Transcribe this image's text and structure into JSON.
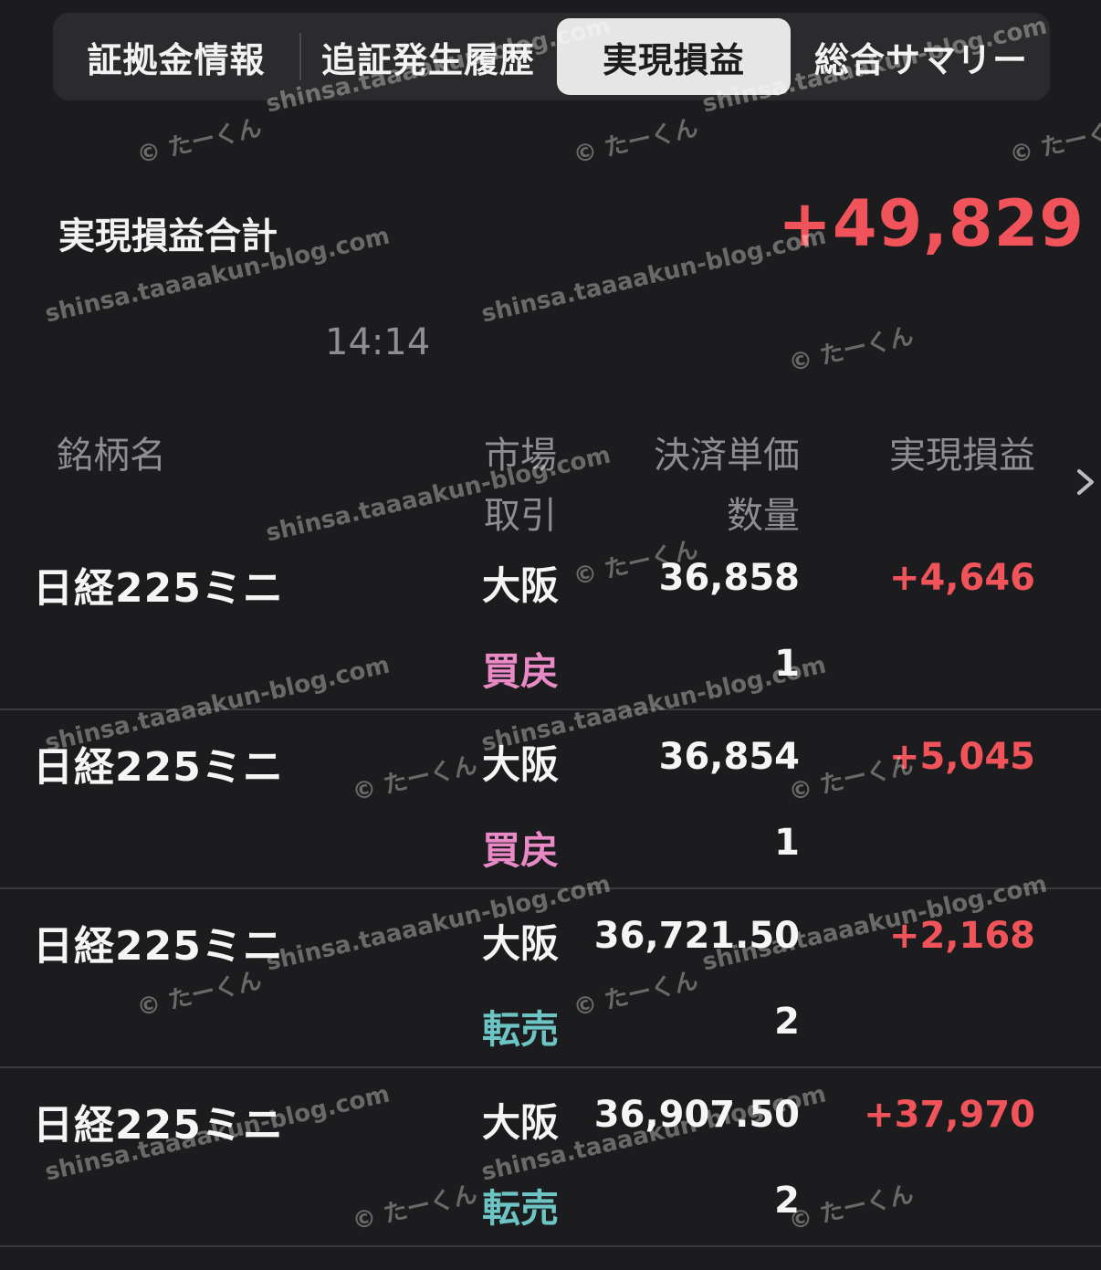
{
  "tabs": [
    {
      "label": "証拠金情報"
    },
    {
      "label": "追証発生履歴"
    },
    {
      "label": "実現損益"
    },
    {
      "label": "総合サマリー"
    }
  ],
  "summary": {
    "label": "実現損益合計",
    "value": "+49,829"
  },
  "timestamp": "14:14",
  "columns": {
    "name": "銘柄名",
    "market": "市場",
    "trade": "取引",
    "price": "決済単価",
    "quantity": "数量",
    "pnl": "実現損益"
  },
  "rows": [
    {
      "name": "日経225ミニ",
      "market": "大阪",
      "trade": "買戻",
      "trade_type": "buyback",
      "price": "36,858",
      "quantity": "1",
      "pnl": "+4,646"
    },
    {
      "name": "日経225ミニ",
      "market": "大阪",
      "trade": "買戻",
      "trade_type": "buyback",
      "price": "36,854",
      "quantity": "1",
      "pnl": "+5,045"
    },
    {
      "name": "日経225ミニ",
      "market": "大阪",
      "trade": "転売",
      "trade_type": "resell",
      "price": "36,721.50",
      "quantity": "2",
      "pnl": "+2,168"
    },
    {
      "name": "日経225ミニ",
      "market": "大阪",
      "trade": "転売",
      "trade_type": "resell",
      "price": "36,907.50",
      "quantity": "2",
      "pnl": "+37,970"
    }
  ],
  "watermark": {
    "site": "shinsa.taaaakun-blog.com",
    "author": "© たーくん"
  },
  "colors": {
    "background": "#1c1c1e",
    "positive": "#f0545a",
    "buyback": "#e98ac7",
    "resell": "#6cc4c4"
  },
  "icons": {
    "detail": "chevron-right-icon"
  }
}
